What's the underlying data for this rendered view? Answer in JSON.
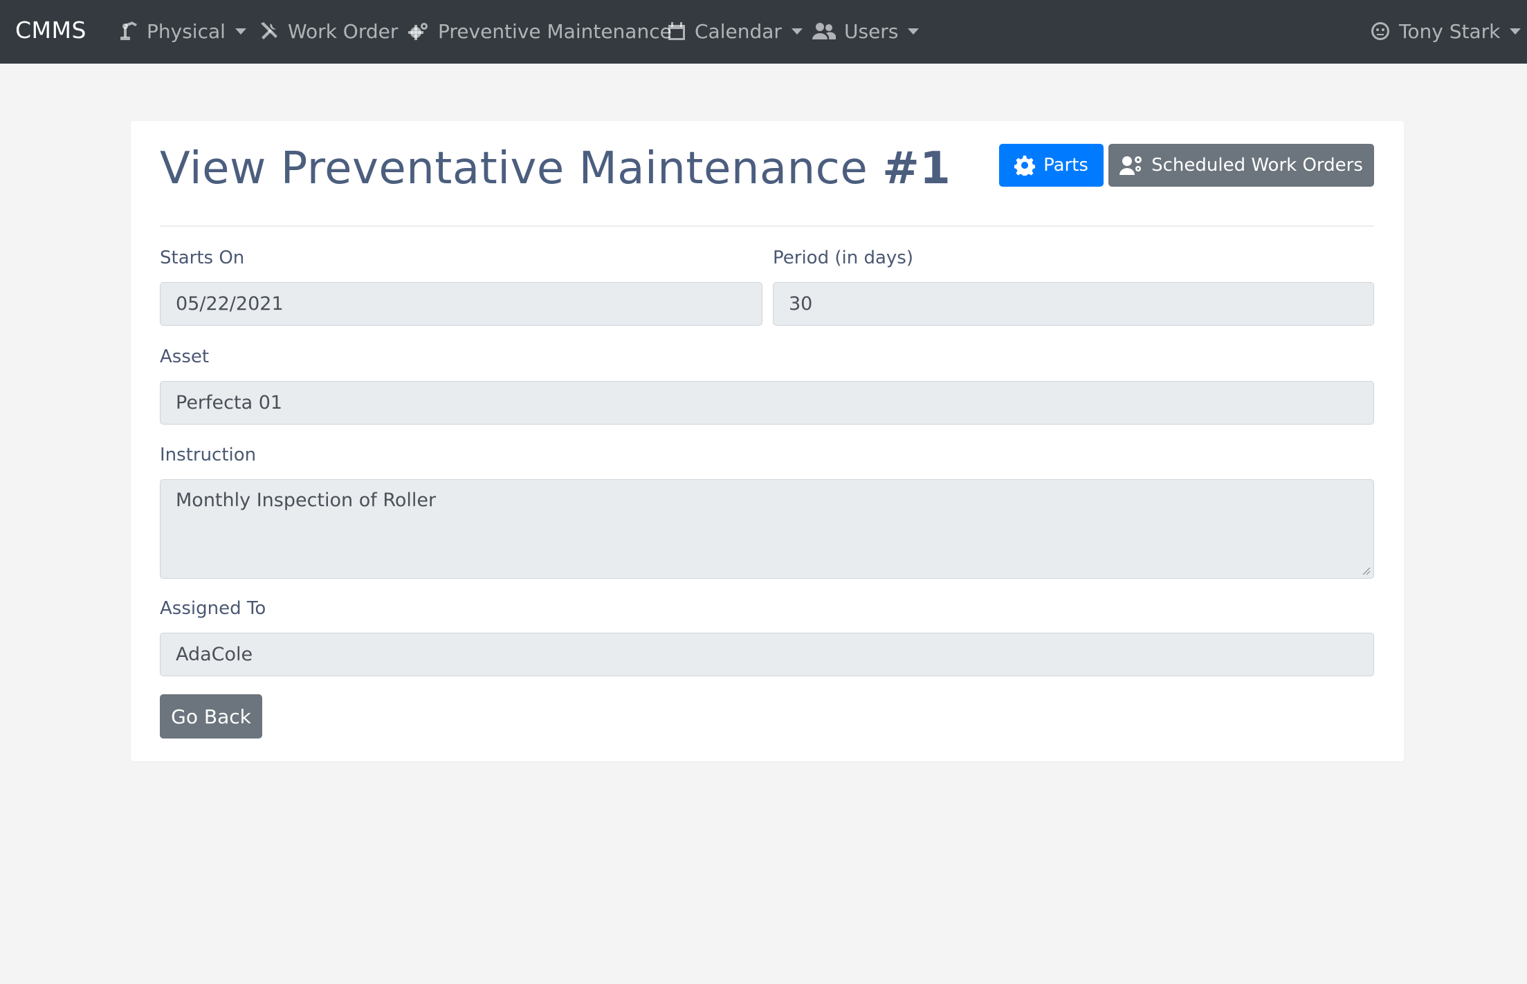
{
  "navbar": {
    "brand": "CMMS",
    "items": [
      {
        "label": "Physical",
        "icon": "robot-arm-icon",
        "dropdown": true
      },
      {
        "label": "Work Order",
        "icon": "tools-icon",
        "dropdown": false
      },
      {
        "label": "Preventive Maintenance",
        "icon": "cogs-icon",
        "dropdown": false
      },
      {
        "label": "Calendar",
        "icon": "calendar-icon",
        "dropdown": true
      },
      {
        "label": "Users",
        "icon": "users-icon",
        "dropdown": true
      }
    ],
    "user": {
      "label": "Tony Stark",
      "icon": "face-icon",
      "dropdown": true
    }
  },
  "page": {
    "title_prefix": "View Preventative Maintenance ",
    "title_number": "#1",
    "parts_button": "Parts",
    "scheduled_button": "Scheduled Work Orders",
    "go_back_button": "Go Back"
  },
  "form": {
    "starts_on": {
      "label": "Starts On",
      "value": "05/22/2021"
    },
    "period": {
      "label": "Period (in days)",
      "value": "30"
    },
    "asset": {
      "label": "Asset",
      "value": "Perfecta 01"
    },
    "instruction": {
      "label": "Instruction",
      "value": "Monthly Inspection of Roller"
    },
    "assigned_to": {
      "label": "Assigned To",
      "value": "AdaCole"
    }
  },
  "colors": {
    "navbar_bg": "#343a40",
    "primary": "#007bff",
    "secondary": "#6c757d",
    "page_bg": "#f4f4f4",
    "field_bg": "#e9ecef"
  }
}
